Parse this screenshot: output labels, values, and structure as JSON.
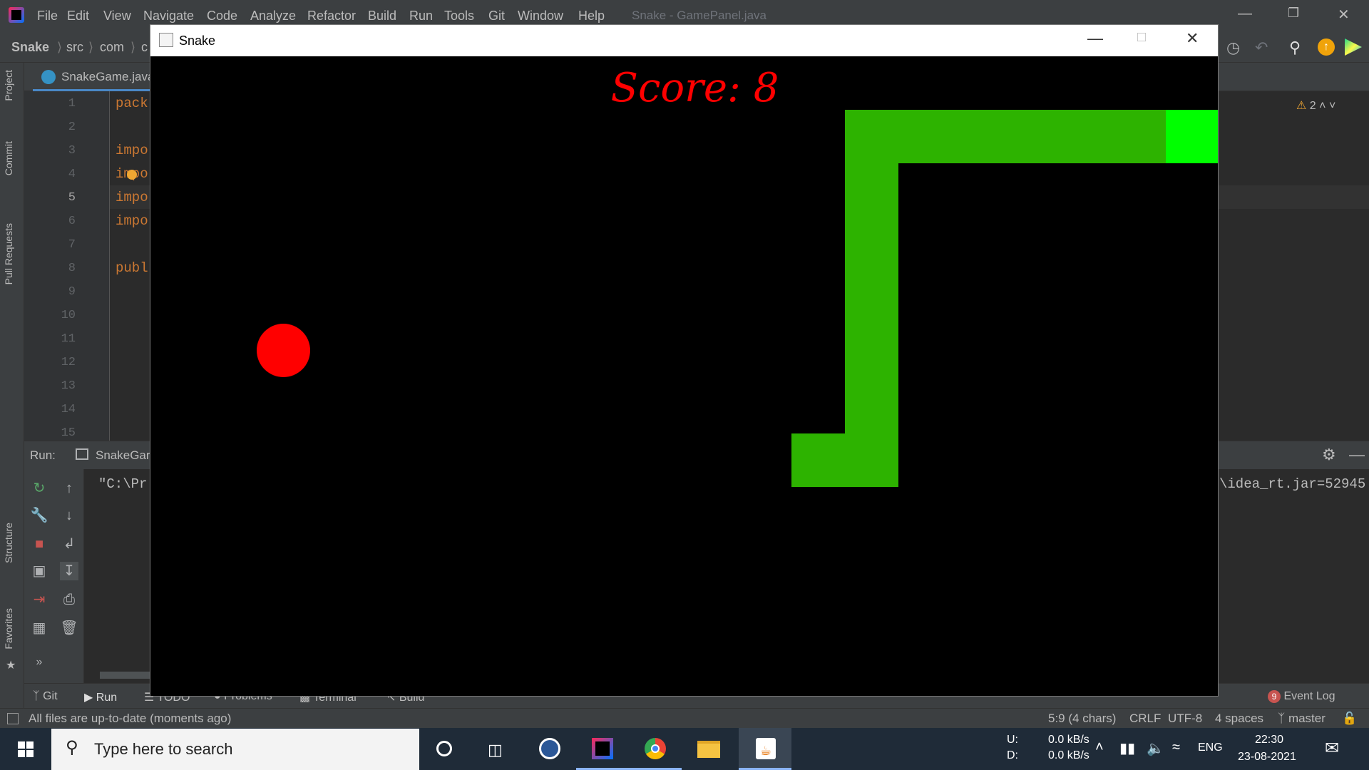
{
  "ide": {
    "menu": [
      "File",
      "Edit",
      "View",
      "Navigate",
      "Code",
      "Analyze",
      "Refactor",
      "Build",
      "Run",
      "Tools",
      "Git",
      "Window",
      "Help"
    ],
    "window_title": "Snake - GamePanel.java",
    "breadcrumb": [
      "Snake",
      "src",
      "com",
      "c"
    ],
    "left_tools": [
      "Project",
      "Commit",
      "Pull Requests",
      "Structure",
      "Favorites"
    ],
    "file_tab": "SnakeGame.java",
    "line_numbers": [
      "1",
      "2",
      "3",
      "4",
      "5",
      "6",
      "7",
      "8",
      "9",
      "10",
      "11",
      "12",
      "13",
      "14",
      "15"
    ],
    "code_lines": [
      {
        "line": 1,
        "text": "pack"
      },
      {
        "line": 3,
        "text": "impo"
      },
      {
        "line": 4,
        "text": "impo"
      },
      {
        "line": 5,
        "text": "impo"
      },
      {
        "line": 6,
        "text": "impo"
      },
      {
        "line": 8,
        "text": "publ"
      }
    ],
    "warnings_count": "2",
    "run_label": "Run:",
    "run_tab": "SnakeGar",
    "console_left": "\"C:\\Pr",
    "console_right": "\\idea_rt.jar=52945",
    "bottom_tabs": [
      "Git",
      "Run",
      "TODO",
      "Problems",
      "Terminal",
      "Build"
    ],
    "event_log": "Event Log",
    "event_log_count": "9",
    "status_message": "All files are up-to-date (moments ago)",
    "status_right": {
      "position": "5:9 (4 chars)",
      "line_sep": "CRLF",
      "encoding": "UTF-8",
      "indent": "4 spaces",
      "branch": "master"
    }
  },
  "snake_window": {
    "title": "Snake",
    "score_label": "Score: 8",
    "score": 8,
    "colors": {
      "background": "#000000",
      "body": "#2db300",
      "head": "#00ff00",
      "apple": "#ff0000",
      "score": "#ff0000"
    }
  },
  "taskbar": {
    "search_placeholder": "Type here to search",
    "net_up_label": "U:",
    "net_down_label": "D:",
    "net_up": "0.0 kB/s",
    "net_down": "0.0 kB/s",
    "lang": "ENG",
    "time": "22:30",
    "date": "23-08-2021"
  }
}
